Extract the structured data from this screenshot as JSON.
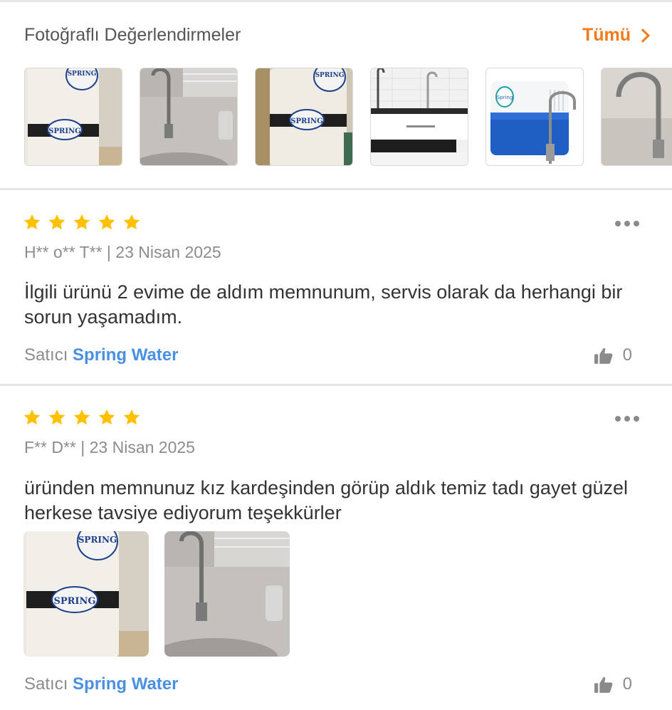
{
  "photo_section": {
    "title": "Fotoğraflı Değerlendirmeler",
    "see_all": "Tümü",
    "thumbnails": [
      {
        "brand_top": "SPRING",
        "brand_mid": "SPRING"
      },
      {},
      {
        "brand_top": "SPRING",
        "brand_mid": "SPRING"
      },
      {},
      {
        "brand": "Spring"
      },
      {}
    ]
  },
  "reviews": [
    {
      "rating": 5,
      "author": "H** o** T**",
      "separator": "|",
      "date": "23 Nisan 2025",
      "text": "İlgili ürünü 2 evime de aldım memnunum, servis olarak da herhangi bir sorun yaşamadım.",
      "seller_label": "Satıcı",
      "seller_name": "Spring Water",
      "likes": "0"
    },
    {
      "rating": 5,
      "author": "F** D**",
      "separator": "|",
      "date": "23 Nisan 2025",
      "text": "üründen memnunuz kız kardeşinden görüp aldık temiz tadı  gayet güzel herkese tavsiye  ediyorum teşekkürler",
      "seller_label": "Satıcı",
      "seller_name": "Spring Water",
      "likes": "0"
    }
  ],
  "colors": {
    "accent": "#f27a1a",
    "star": "#ffc000",
    "seller_link": "#4a90e2",
    "muted_text": "#8c8c8c",
    "divider": "#e6e6e6"
  },
  "icons": [
    "star-icon",
    "more-options-icon",
    "thumbs-up-icon",
    "chevron-right-icon"
  ]
}
